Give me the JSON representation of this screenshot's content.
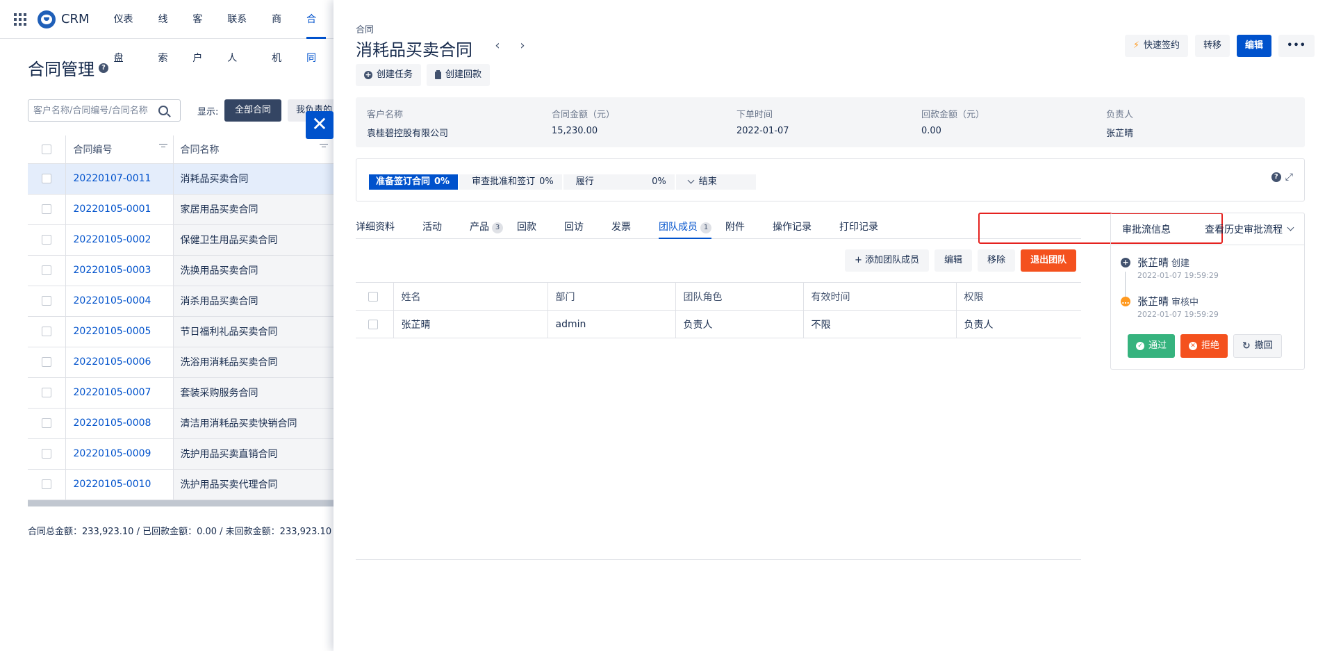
{
  "nav": {
    "brand": "CRM",
    "items": [
      "仪表盘",
      "线索",
      "客户",
      "联系人",
      "商机",
      "合同"
    ],
    "active_index": 5
  },
  "list": {
    "title": "合同管理",
    "search_placeholder": "客户名称/合同编号/合同名称",
    "show_label": "显示:",
    "filter_all": "全部合同",
    "filter_mine": "我负责的",
    "columns": {
      "no": "合同编号",
      "name": "合同名称"
    },
    "rows": [
      {
        "no": "20220107-0011",
        "name": "消耗品买卖合同"
      },
      {
        "no": "20220105-0001",
        "name": "家居用品买卖合同"
      },
      {
        "no": "20220105-0002",
        "name": "保健卫生用品买卖合同"
      },
      {
        "no": "20220105-0003",
        "name": "洗换用品买卖合同"
      },
      {
        "no": "20220105-0004",
        "name": "消杀用品买卖合同"
      },
      {
        "no": "20220105-0005",
        "name": "节日福利礼品买卖合同"
      },
      {
        "no": "20220105-0006",
        "name": "洗浴用消耗品买卖合同"
      },
      {
        "no": "20220105-0007",
        "name": "套装采购服务合同"
      },
      {
        "no": "20220105-0008",
        "name": "清洁用消耗品买卖快销合同"
      },
      {
        "no": "20220105-0009",
        "name": "洗护用品买卖直销合同"
      },
      {
        "no": "20220105-0010",
        "name": "洗护用品买卖代理合同"
      }
    ],
    "totals": "合同总金额：233,923.10 / 已回款金额：0.00 / 未回款金额：233,923.10"
  },
  "detail": {
    "crumb": "合同",
    "title": "消耗品买卖合同",
    "prev": "‹",
    "next": "›",
    "actions": {
      "quick_sign": "快速签约",
      "transfer": "转移",
      "edit": "编辑",
      "more": "•••"
    },
    "sub_actions": {
      "create_task": "创建任务",
      "create_payment": "创建回款"
    },
    "summary": [
      {
        "label": "客户名称",
        "value": "袁桂碧控股有限公司"
      },
      {
        "label": "合同金额（元）",
        "value": "15,230.00"
      },
      {
        "label": "下单时间",
        "value": "2022-01-07"
      },
      {
        "label": "回款金额（元）",
        "value": "0.00"
      },
      {
        "label": "负责人",
        "value": "张芷晴"
      }
    ],
    "stages": [
      {
        "name": "准备签订合同",
        "pct": "0%"
      },
      {
        "name": "审查批准和签订",
        "pct": "0%"
      },
      {
        "name": "履行",
        "pct": "0%"
      },
      {
        "name": "结束",
        "pct": ""
      }
    ],
    "tabs": [
      {
        "label": "详细资料",
        "badge": ""
      },
      {
        "label": "活动",
        "badge": ""
      },
      {
        "label": "产品",
        "badge": "3"
      },
      {
        "label": "回款",
        "badge": ""
      },
      {
        "label": "回访",
        "badge": ""
      },
      {
        "label": "发票",
        "badge": ""
      },
      {
        "label": "团队成员",
        "badge": "1"
      },
      {
        "label": "附件",
        "badge": ""
      },
      {
        "label": "操作记录",
        "badge": ""
      },
      {
        "label": "打印记录",
        "badge": ""
      }
    ],
    "active_tab": "团队成员",
    "team_actions": {
      "add": "+ 添加团队成员",
      "edit": "编辑",
      "remove": "移除",
      "exit": "退出团队"
    },
    "team_columns": [
      "姓名",
      "部门",
      "团队角色",
      "有效时间",
      "权限"
    ],
    "team_rows": [
      [
        "张芷晴",
        "admin",
        "负责人",
        "不限",
        "负责人"
      ]
    ]
  },
  "approval": {
    "title": "审批流信息",
    "history_link": "查看历史审批流程",
    "steps": [
      {
        "name": "张芷晴",
        "status": "创建",
        "time": "2022-01-07 19:59:29"
      },
      {
        "name": "张芷晴",
        "status": "审核中",
        "time": "2022-01-07 19:59:29"
      }
    ],
    "buttons": {
      "pass": "通过",
      "reject": "拒绝",
      "revoke": "撤回"
    }
  }
}
